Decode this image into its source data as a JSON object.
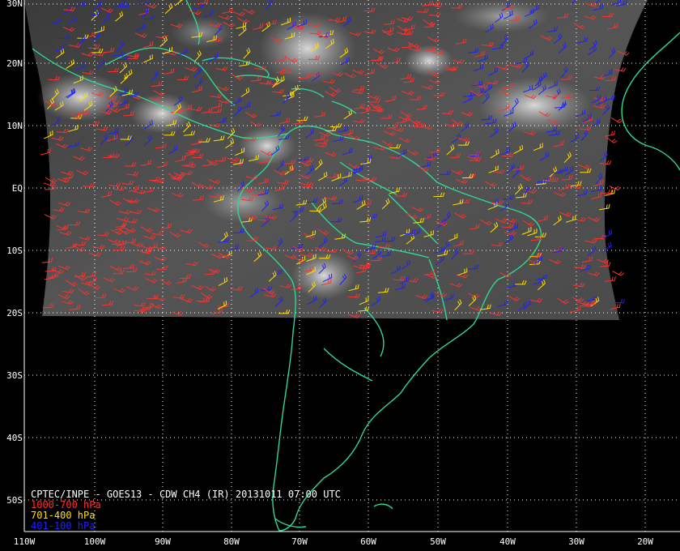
{
  "map": {
    "caption": {
      "title": "CPTEC/INPE - GOES13 - CDW CH4 (IR) 20131011 07:00 UTC",
      "legend": [
        {
          "label": "1000-700 hPa",
          "color": "#ff3030"
        },
        {
          "label": "701-400 hPa",
          "color": "#ffe000"
        },
        {
          "label": "401-100 hPa",
          "color": "#2020ff"
        }
      ]
    },
    "lat_labels": [
      "30N",
      "20N",
      "10N",
      "EQ",
      "10S",
      "20S",
      "30S",
      "40S",
      "50S"
    ],
    "lon_labels": [
      "110W",
      "100W",
      "90W",
      "80W",
      "70W",
      "60W",
      "50W",
      "40W",
      "30W",
      "20W"
    ],
    "colors": {
      "background": "#000000",
      "coastline": "#30d890",
      "grid": "#ffffff",
      "frame": "#ffffff"
    }
  }
}
